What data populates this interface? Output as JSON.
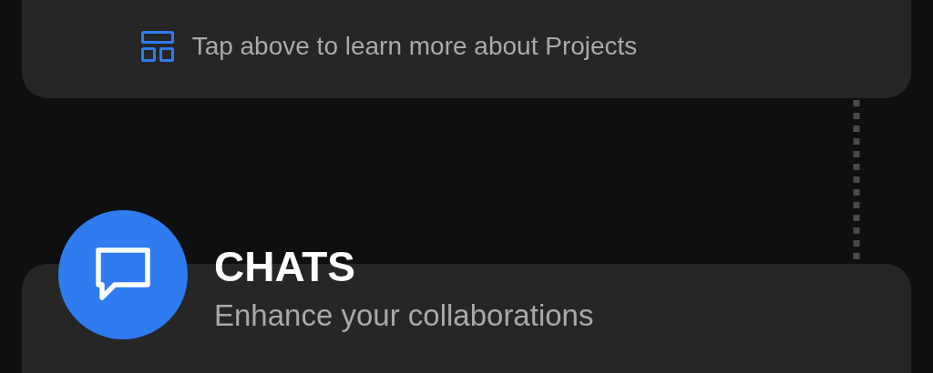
{
  "projects_card": {
    "hint": "Tap above to learn more about Projects"
  },
  "chats_section": {
    "title": "CHATS",
    "subtitle": "Enhance your collaborations"
  }
}
